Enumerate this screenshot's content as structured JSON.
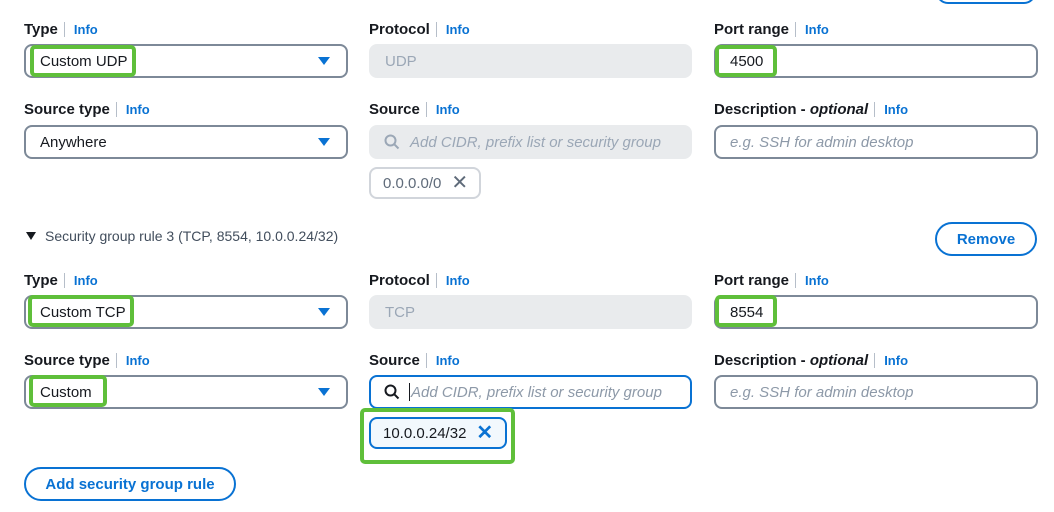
{
  "info_label": "Info",
  "rule2": {
    "type_label": "Type",
    "type_value": "Custom UDP",
    "protocol_label": "Protocol",
    "protocol_value": "UDP",
    "port_label": "Port range",
    "port_value": "4500",
    "source_type_label": "Source type",
    "source_type_value": "Anywhere",
    "source_label": "Source",
    "source_placeholder": "Add CIDR, prefix list or security group",
    "source_token": "0.0.0.0/0",
    "description_label": "Description - ",
    "description_optional": "optional",
    "description_placeholder": "e.g. SSH for admin desktop"
  },
  "rule3": {
    "header": "Security group rule 3 (TCP, 8554, 10.0.0.24/32)",
    "remove_label": "Remove",
    "type_label": "Type",
    "type_value": "Custom TCP",
    "protocol_label": "Protocol",
    "protocol_value": "TCP",
    "port_label": "Port range",
    "port_value": "8554",
    "source_type_label": "Source type",
    "source_type_value": "Custom",
    "source_label": "Source",
    "source_placeholder": "Add CIDR, prefix list or security group",
    "source_token": "10.0.0.24/32",
    "description_label": "Description - ",
    "description_optional": "optional",
    "description_placeholder": "e.g. SSH for admin desktop"
  },
  "add_rule_label": "Add security group rule",
  "colors": {
    "accent": "#0972d3",
    "highlight": "#5fbf3a",
    "border": "#7d8998",
    "disabled": "#e9ebed"
  }
}
